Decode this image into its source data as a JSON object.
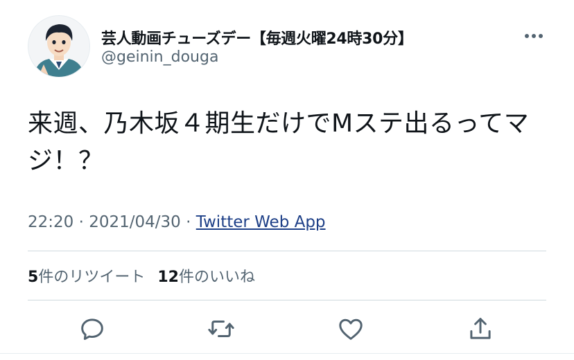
{
  "tweet": {
    "display_name": "芸人動画チューズデー【毎週火曜24時30分】",
    "handle": "@geinin_douga",
    "text": "来週、乃木坂４期生だけでMステ出るってマジ！？",
    "time": "22:20",
    "date": "2021/04/30",
    "separator": "·",
    "source": "Twitter Web App"
  },
  "stats": {
    "retweet_count": "5",
    "retweet_label": "件のリツイート",
    "like_count": "12",
    "like_label": "件のいいね"
  },
  "actions": [
    {
      "name": "reply",
      "icon": "reply-icon"
    },
    {
      "name": "retweet",
      "icon": "retweet-icon"
    },
    {
      "name": "like",
      "icon": "heart-icon"
    },
    {
      "name": "share",
      "icon": "share-icon"
    }
  ],
  "colors": {
    "text": "#0f1419",
    "secondary": "#536471",
    "link": "#1d3f87",
    "divider": "#cfd9de"
  }
}
